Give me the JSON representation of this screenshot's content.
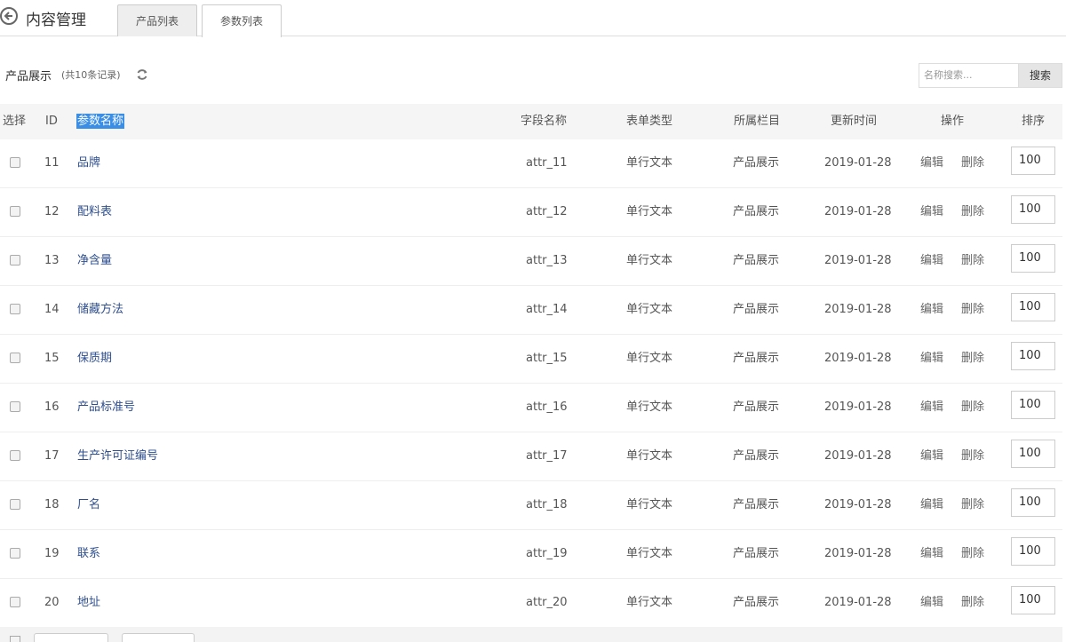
{
  "header": {
    "title": "内容管理",
    "tabs": [
      {
        "label": "产品列表"
      },
      {
        "label": "参数列表"
      }
    ]
  },
  "toolbar": {
    "section_title": "产品展示",
    "count_text": "(共10条记录)",
    "search_placeholder": "名称搜索...",
    "search_label": "搜索"
  },
  "table": {
    "headers": [
      "选择",
      "ID",
      "参数名称",
      "字段名称",
      "表单类型",
      "所属栏目",
      "更新时间",
      "操作",
      "排序"
    ],
    "edit_label": "编辑",
    "delete_label": "删除",
    "rows": [
      {
        "id": "11",
        "name": "品牌",
        "field": "attr_11",
        "type": "单行文本",
        "column": "产品展示",
        "date": "2019-01-28",
        "sort": "100"
      },
      {
        "id": "12",
        "name": "配料表",
        "field": "attr_12",
        "type": "单行文本",
        "column": "产品展示",
        "date": "2019-01-28",
        "sort": "100"
      },
      {
        "id": "13",
        "name": "净含量",
        "field": "attr_13",
        "type": "单行文本",
        "column": "产品展示",
        "date": "2019-01-28",
        "sort": "100"
      },
      {
        "id": "14",
        "name": "储藏方法",
        "field": "attr_14",
        "type": "单行文本",
        "column": "产品展示",
        "date": "2019-01-28",
        "sort": "100"
      },
      {
        "id": "15",
        "name": "保质期",
        "field": "attr_15",
        "type": "单行文本",
        "column": "产品展示",
        "date": "2019-01-28",
        "sort": "100"
      },
      {
        "id": "16",
        "name": "产品标准号",
        "field": "attr_16",
        "type": "单行文本",
        "column": "产品展示",
        "date": "2019-01-28",
        "sort": "100"
      },
      {
        "id": "17",
        "name": "生产许可证编号",
        "field": "attr_17",
        "type": "单行文本",
        "column": "产品展示",
        "date": "2019-01-28",
        "sort": "100"
      },
      {
        "id": "18",
        "name": "厂名",
        "field": "attr_18",
        "type": "单行文本",
        "column": "产品展示",
        "date": "2019-01-28",
        "sort": "100"
      },
      {
        "id": "19",
        "name": "联系",
        "field": "attr_19",
        "type": "单行文本",
        "column": "产品展示",
        "date": "2019-01-28",
        "sort": "100"
      },
      {
        "id": "20",
        "name": "地址",
        "field": "attr_20",
        "type": "单行文本",
        "column": "产品展示",
        "date": "2019-01-28",
        "sort": "100"
      }
    ]
  },
  "icons": {
    "back": "arrow-left-circle-icon",
    "refresh": "refresh-icon"
  },
  "colors": {
    "link": "#2f4f8f",
    "highlight": "#3a8ee6",
    "header_bg": "#f5f5f5"
  }
}
